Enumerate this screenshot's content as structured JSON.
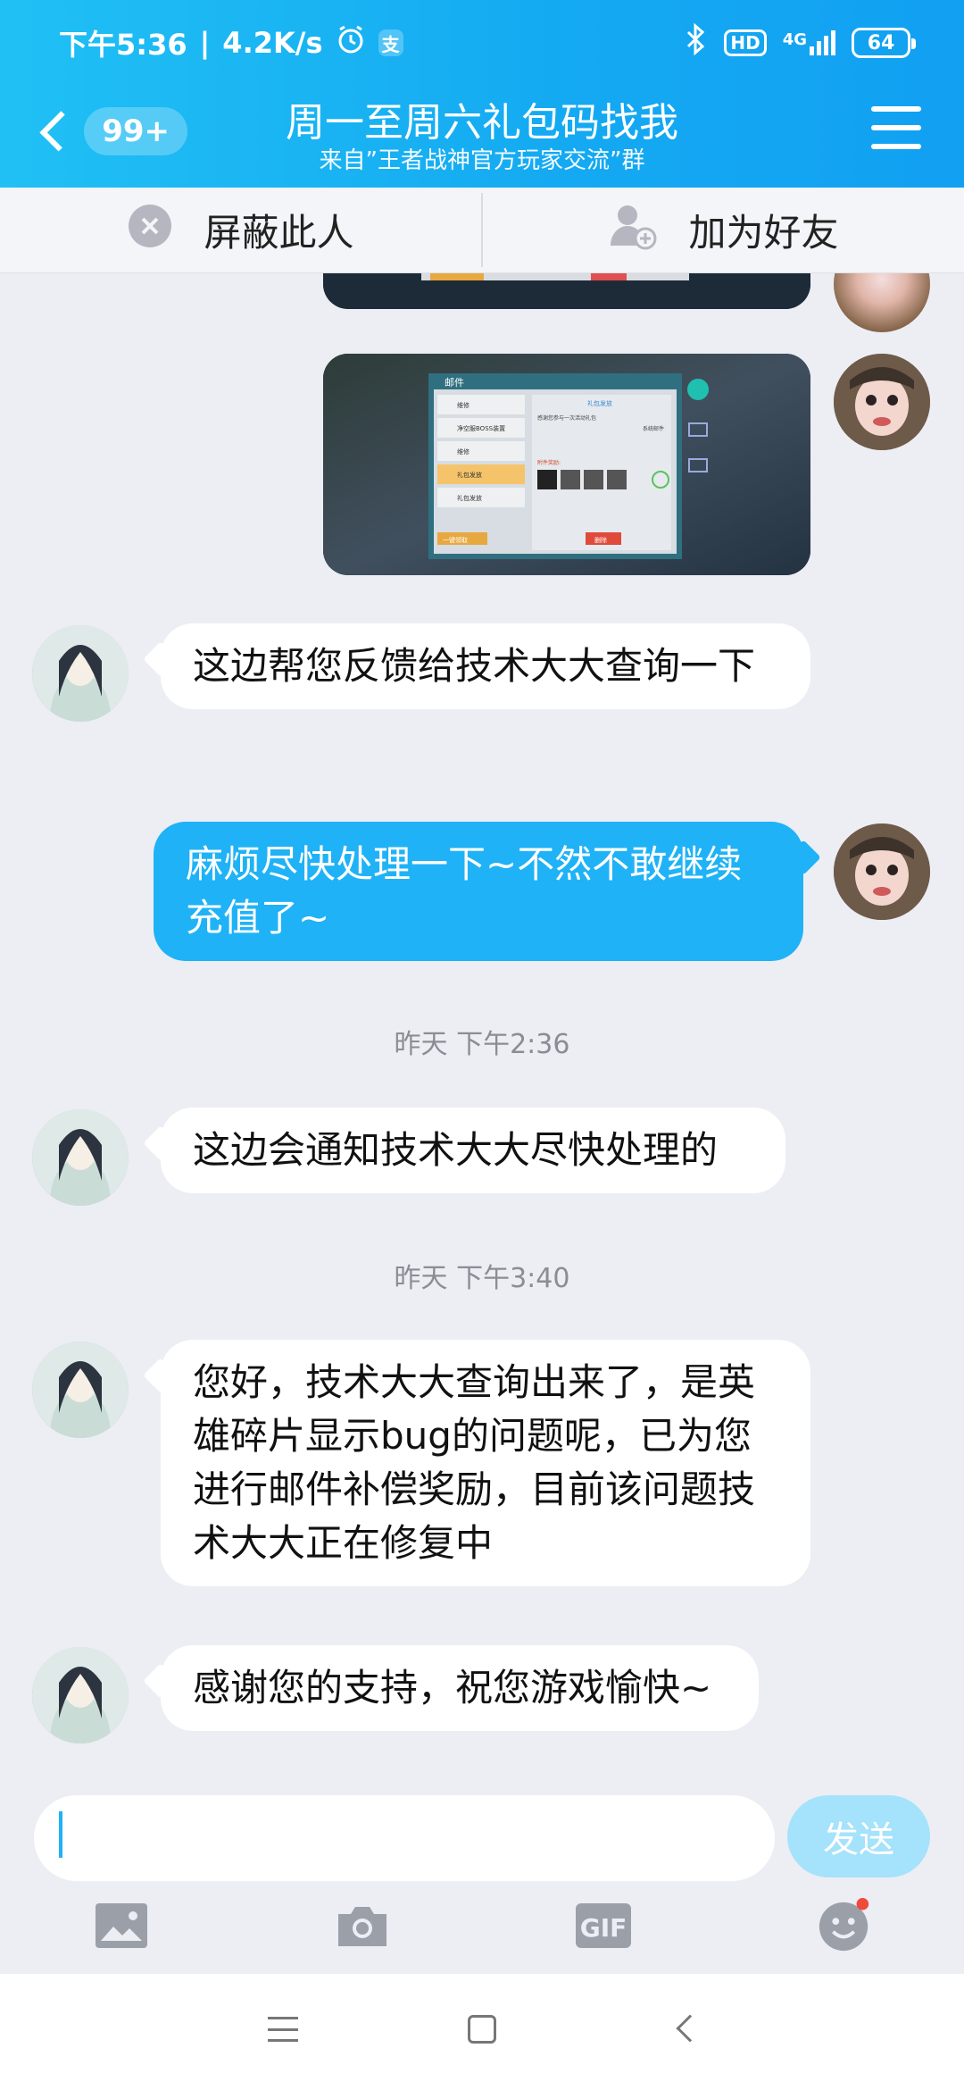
{
  "status_bar": {
    "time": "下午5:36",
    "speed": "4.2K/s",
    "alarm_icon": "alarm-icon",
    "app_badge": "支",
    "hd": "HD",
    "network": "4G",
    "battery": "64"
  },
  "header": {
    "back_badge": "99+",
    "title": "周一至周六礼包码找我",
    "subtitle": "来自”王者战神官方玩家交流”群"
  },
  "actions": {
    "block": "屏蔽此人",
    "add_friend": "加为好友"
  },
  "mail_image": {
    "title": "邮件",
    "items": [
      "维修",
      "净空服BOSS装置",
      "维修",
      "礼包发放",
      "礼包发放"
    ],
    "dates": [
      "2022-02-11",
      "2022-02-11",
      "2022-02-11",
      "2022-02-11",
      "2022-02-11"
    ],
    "claim_all": "一键领取",
    "detail_title": "礼包发放",
    "detail_text": "感谢您参与一次活动礼包，已获得奖励如下：",
    "detail_right": "系统邮件",
    "attachment_label": "附件奖励:",
    "delete": "删除"
  },
  "messages": [
    {
      "side": "left",
      "text": "这边帮您反馈给技术大大查询一下"
    },
    {
      "side": "right",
      "text": "麻烦尽快处理一下~不然不敢继续充值了~"
    },
    {
      "side": "left",
      "text": "这边会通知技术大大尽快处理的"
    },
    {
      "side": "left",
      "text": "您好，技术大大查询出来了，是英雄碎片显示bug的问题呢，已为您进行邮件补偿奖励，目前该问题技术大大正在修复中"
    },
    {
      "side": "left",
      "text": "感谢您的支持，祝您游戏愉快~"
    }
  ],
  "timestamps": [
    "昨天  下午2:36",
    "昨天  下午3:40"
  ],
  "input": {
    "value": "",
    "send": "发送",
    "gif": "GIF"
  },
  "colors": {
    "header": "#14a9f2",
    "own_bubble": "#1fb2f6",
    "send_disabled": "#a5e2fb",
    "notification_dot": "#f04a3a"
  },
  "icons": [
    "back-chevron-icon",
    "menu-icon",
    "block-icon",
    "add-friend-icon",
    "image-icon",
    "camera-icon",
    "gif-icon",
    "emoji-icon",
    "nav-menu-icon",
    "nav-home-icon",
    "nav-back-icon"
  ]
}
